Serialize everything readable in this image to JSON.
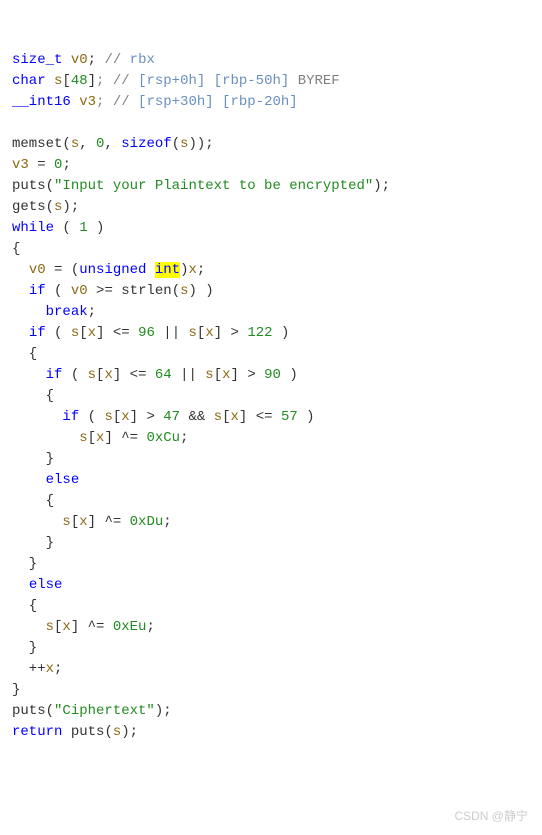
{
  "l1": {
    "t1": "size_t",
    "v1": "v0",
    "c1": "// ",
    "r1": "rbx"
  },
  "l2": {
    "t1": "char",
    "v1": "s",
    "sz": "48",
    "c1": "; // ",
    "r1": "[rsp+0h] [rbp-50h]",
    "byref": " BYREF"
  },
  "l3": {
    "t1": "__int16",
    "v1": "v3",
    "c1": "; // ",
    "r1": "[rsp+30h] [rbp-20h]"
  },
  "l5": {
    "f": "memset",
    "v1": "s",
    "n1": "0",
    "t1": "sizeof",
    "v2": "s"
  },
  "l6": {
    "v1": "v3",
    "n1": "0"
  },
  "l7": {
    "f": "puts",
    "s": "\"Input your Plaintext to be encrypted\""
  },
  "l8": {
    "f": "gets",
    "v": "s"
  },
  "l9": {
    "kw": "while",
    "n": "1"
  },
  "l11": {
    "v1": "v0",
    "k1": "unsigned",
    "k2": "int",
    "v2": "x"
  },
  "l12": {
    "kw": "if",
    "v1": "v0",
    "f": "strlen",
    "v2": "s"
  },
  "l13": {
    "kw": "break"
  },
  "l14": {
    "kw": "if",
    "v1": "s",
    "v2": "x",
    "n1": "96",
    "v3": "s",
    "v4": "x",
    "n2": "122"
  },
  "l16": {
    "kw": "if",
    "v1": "s",
    "v2": "x",
    "n1": "64",
    "v3": "s",
    "v4": "x",
    "n2": "90"
  },
  "l18": {
    "kw": "if",
    "v1": "s",
    "v2": "x",
    "n1": "47",
    "v3": "s",
    "v4": "x",
    "n2": "57"
  },
  "l19": {
    "v1": "s",
    "v2": "x",
    "h": "0xCu"
  },
  "l21": {
    "kw": "else"
  },
  "l23": {
    "v1": "s",
    "v2": "x",
    "h": "0xDu"
  },
  "l26": {
    "kw": "else"
  },
  "l28": {
    "v1": "s",
    "v2": "x",
    "h": "0xEu"
  },
  "l30": {
    "v": "x"
  },
  "l32": {
    "f": "puts",
    "s": "\"Ciphertext\""
  },
  "l33": {
    "kw": "return",
    "f": "puts",
    "v": "s"
  },
  "watermark": "CSDN @静宁"
}
